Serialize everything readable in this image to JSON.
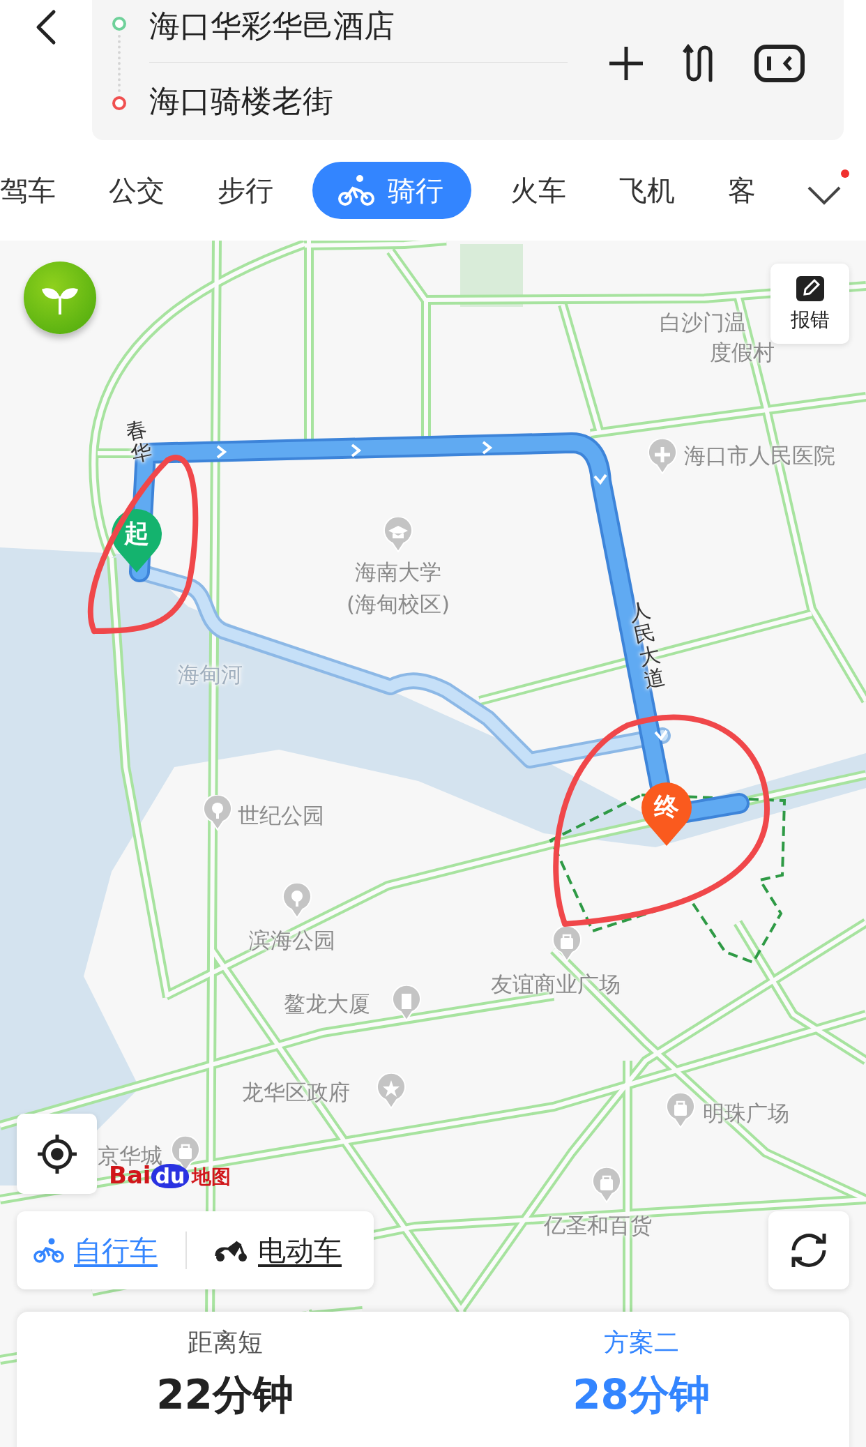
{
  "route_inputs": {
    "origin": "海口华彩华邑酒店",
    "destination": "海口骑楼老街"
  },
  "modes": [
    {
      "label": "驾车",
      "selected": false
    },
    {
      "label": "公交",
      "selected": false
    },
    {
      "label": "步行",
      "selected": false
    },
    {
      "label": "骑行",
      "selected": true
    },
    {
      "label": "火车",
      "selected": false
    },
    {
      "label": "飞机",
      "selected": false
    },
    {
      "label": "客",
      "selected": false
    }
  ],
  "mode_menu": {
    "badge": true
  },
  "map": {
    "labels": [
      {
        "text": "白沙门温",
        "kind": "place"
      },
      {
        "text": "度假村",
        "kind": "place"
      },
      {
        "text": "海口市人民医院",
        "kind": "poi"
      },
      {
        "text": "海南大学",
        "kind": "poi"
      },
      {
        "text": "(海甸校区)",
        "kind": "place"
      },
      {
        "text": "海甸河",
        "kind": "water"
      },
      {
        "text": "春华",
        "kind": "road"
      },
      {
        "text": "人民大道",
        "kind": "road"
      },
      {
        "text": "世纪公园",
        "kind": "poi"
      },
      {
        "text": "滨海公园",
        "kind": "poi"
      },
      {
        "text": "鳌龙大厦",
        "kind": "poi"
      },
      {
        "text": "友谊商业广场",
        "kind": "poi"
      },
      {
        "text": "龙华区政府",
        "kind": "poi"
      },
      {
        "text": "明珠广场",
        "kind": "poi"
      },
      {
        "text": "京华城",
        "kind": "poi"
      },
      {
        "text": "亿圣和百货",
        "kind": "poi"
      }
    ],
    "start_marker": "起",
    "end_marker": "终",
    "report_button": "报错",
    "logo": {
      "part_1": "Bai",
      "part_2": "du",
      "part_3": "地图"
    }
  },
  "vehicle_types": [
    {
      "label": "自行车",
      "selected": true
    },
    {
      "label": "电动车",
      "selected": false
    }
  ],
  "plans": [
    {
      "tag": "距离短",
      "time": "22分钟",
      "selected": false
    },
    {
      "tag": "方案二",
      "time": "28分钟",
      "selected": true
    }
  ]
}
